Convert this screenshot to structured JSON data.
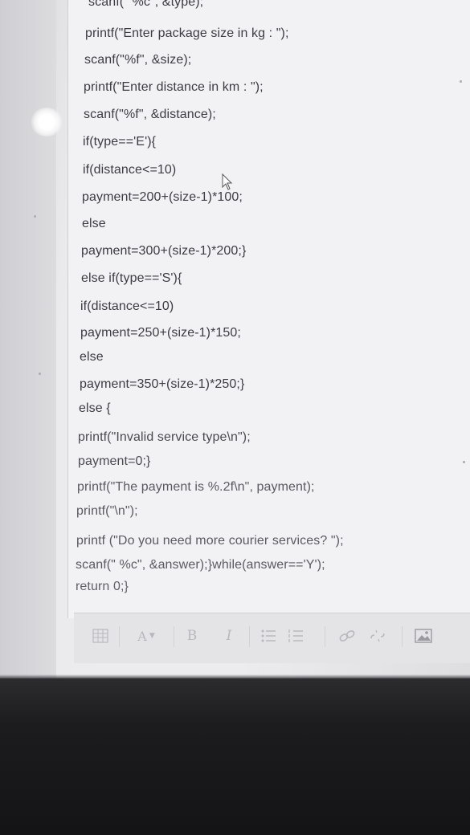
{
  "code_lines": [
    "scanf(\" %c\", &type);",
    "printf(\"Enter package size in kg : \");",
    "scanf(\"%f\", &size);",
    "printf(\"Enter distance in km : \");",
    "scanf(\"%f\", &distance);",
    "if(type=='E'){",
    "if(distance<=10)",
    "payment=200+(size-1)*100;",
    "else",
    "payment=300+(size-1)*200;}",
    "else if(type=='S'){",
    "if(distance<=10)",
    "payment=250+(size-1)*150;",
    "else",
    "payment=350+(size-1)*250;}",
    "else {",
    "printf(\"Invalid service type\\n\");",
    "payment=0;}",
    "printf(\"The payment is %.2f\\n\", payment);",
    "printf(\"\\n\");",
    "printf (\"Do you need more courier services? \");",
    "scanf(\" %c\", &answer);}while(answer=='Y');",
    "return 0;}"
  ],
  "toolbar": {
    "format_icon": "table-format-icon",
    "font_size_label": "A",
    "bold_label": "B",
    "italic_label": "I",
    "unordered_list_icon": "bullet-list-icon",
    "ordered_list_icon": "numbered-list-icon",
    "link_icon": "link-icon",
    "unlink_icon": "unlink-icon",
    "image_icon": "image-icon"
  },
  "colors": {
    "text": "#3c3c44",
    "editor_bg": "#f2f2f4",
    "toolbar_icon": "#b8b8be",
    "bezel": "#1c1c1e"
  }
}
